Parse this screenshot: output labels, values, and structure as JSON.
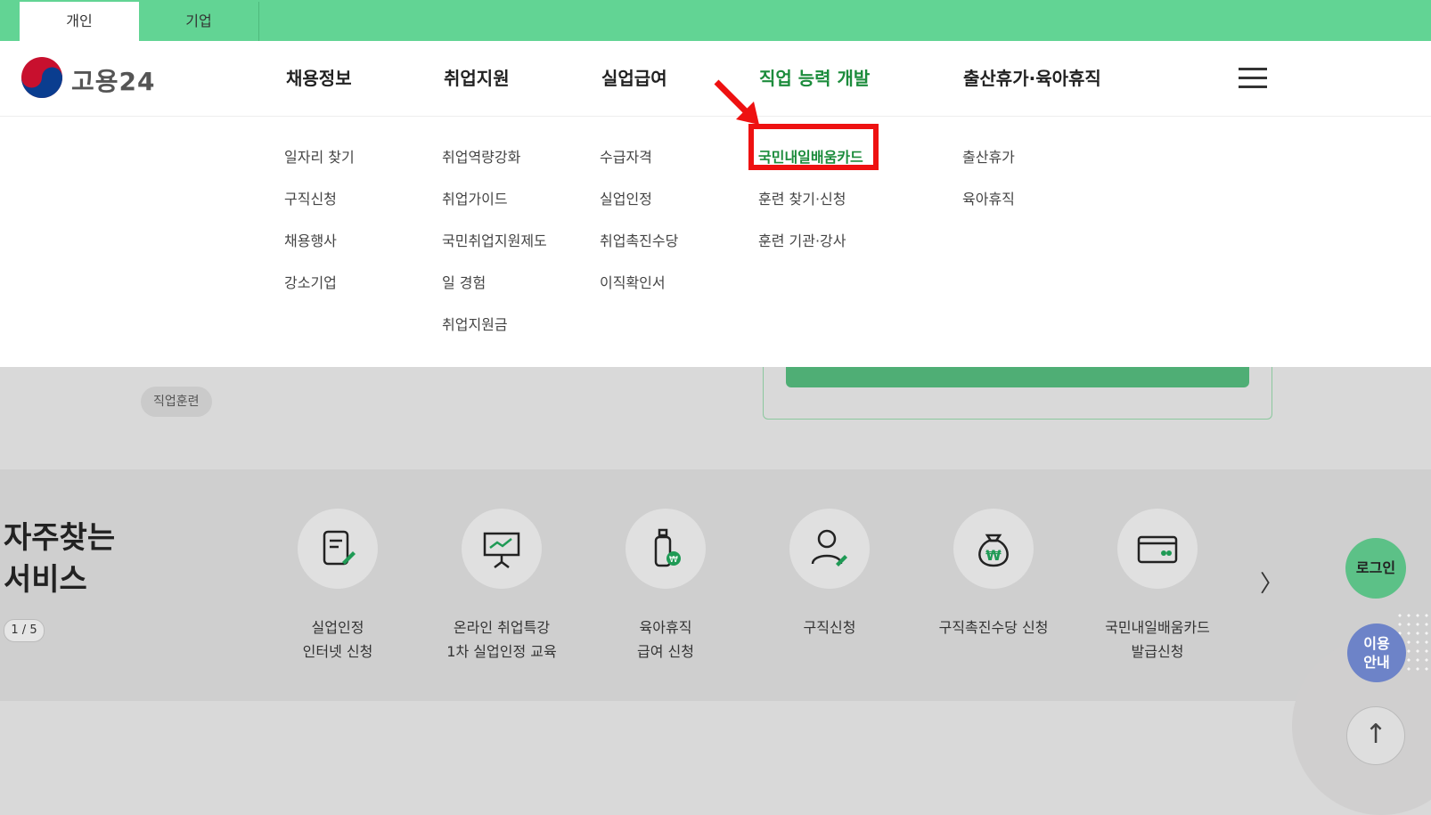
{
  "topTabs": [
    "개인",
    "기업"
  ],
  "logo": {
    "text": "고용24"
  },
  "gnb": [
    "채용정보",
    "취업지원",
    "실업급여",
    "직업 능력 개발",
    "출산휴가·육아휴직"
  ],
  "submenus": {
    "jobInfo": [
      "일자리 찾기",
      "구직신청",
      "채용행사",
      "강소기업"
    ],
    "employmentSupport": [
      "취업역량강화",
      "취업가이드",
      "국민취업지원제도",
      "일 경험",
      "취업지원금"
    ],
    "unemploymentBenefit": [
      "수급자격",
      "실업인정",
      "취업촉진수당",
      "이직확인서"
    ],
    "vocationalTraining": [
      "국민내일배움카드",
      "훈련 찾기·신청",
      "훈련 기관·강사"
    ],
    "parentalLeave": [
      "출산휴가",
      "육아휴직"
    ]
  },
  "tags": [
    "직업훈련"
  ],
  "faq": {
    "titleLine1": "자주찾는",
    "titleLine2": "서비스",
    "pager": "1 / 5",
    "next": "〉",
    "services": [
      {
        "icon": "document-edit-icon",
        "line1": "실업인정",
        "line2": "인터넷 신청"
      },
      {
        "icon": "presentation-icon",
        "line1": "온라인 취업특강",
        "line2": "1차 실업인정 교육"
      },
      {
        "icon": "baby-bottle-icon",
        "line1": "육아휴직",
        "line2": "급여 신청"
      },
      {
        "icon": "user-edit-icon",
        "line1": "구직신청",
        "line2": ""
      },
      {
        "icon": "money-bag-icon",
        "line1": "구직촉진수당 신청",
        "line2": ""
      },
      {
        "icon": "card-icon",
        "line1": "국민내일배움카드",
        "line2": "발급신청"
      }
    ]
  },
  "floating": {
    "login": "로그인",
    "guideLine1": "이용",
    "guideLine2": "안내",
    "top": "↑"
  },
  "colors": {
    "brand": "#62d494",
    "active": "#1c8c3c",
    "highlight": "#ee1111"
  }
}
